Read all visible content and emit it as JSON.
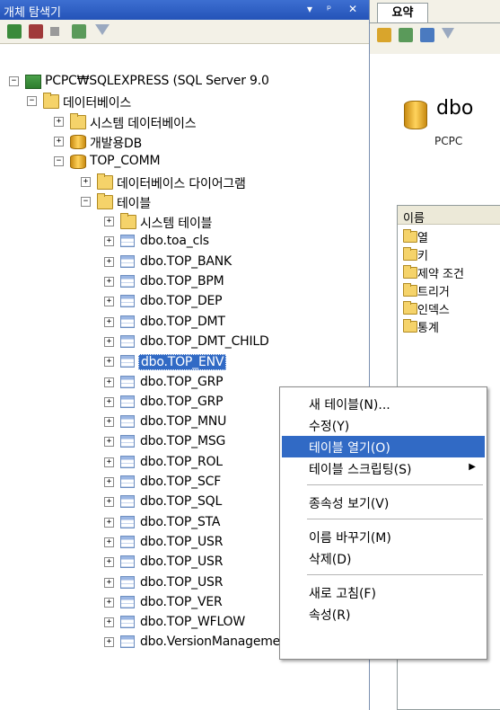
{
  "explorer": {
    "title": "개체 탐색기",
    "controls": [
      "▾",
      "ᵖ",
      "✕"
    ],
    "tree": [
      {
        "label": "PCPC₩SQLEXPRESS (SQL Server 9.0",
        "icon": "server-icon",
        "expander": "−",
        "level": 0
      },
      {
        "label": "데이터베이스",
        "icon": "folder-icon",
        "expander": "−",
        "level": 1
      },
      {
        "label": "시스템 데이터베이스",
        "icon": "folder-icon",
        "expander": "+",
        "level": 2
      },
      {
        "label": "개발용DB",
        "icon": "database-icon",
        "expander": "+",
        "level": 2
      },
      {
        "label": "TOP_COMM",
        "icon": "database-icon",
        "expander": "−",
        "level": 2
      },
      {
        "label": "데이터베이스 다이어그램",
        "icon": "folder-icon",
        "expander": "+",
        "level": 3
      },
      {
        "label": "테이블",
        "icon": "folder-icon",
        "expander": "−",
        "level": 3
      },
      {
        "label": "시스템 테이블",
        "icon": "folder-icon",
        "expander": "+",
        "level": 4
      },
      {
        "label": "dbo.toa_cls",
        "icon": "table-icon",
        "expander": "+",
        "level": 4
      },
      {
        "label": "dbo.TOP_BANK",
        "icon": "table-icon",
        "expander": "+",
        "level": 4
      },
      {
        "label": "dbo.TOP_BPM",
        "icon": "table-icon",
        "expander": "+",
        "level": 4
      },
      {
        "label": "dbo.TOP_DEP",
        "icon": "table-icon",
        "expander": "+",
        "level": 4
      },
      {
        "label": "dbo.TOP_DMT",
        "icon": "table-icon",
        "expander": "+",
        "level": 4
      },
      {
        "label": "dbo.TOP_DMT_CHILD",
        "icon": "table-icon",
        "expander": "+",
        "level": 4
      },
      {
        "label": "dbo.TOP_ENV",
        "icon": "table-icon",
        "expander": "+",
        "level": 4,
        "selected": true
      },
      {
        "label": "dbo.TOP_GRP",
        "icon": "table-icon",
        "expander": "+",
        "level": 4
      },
      {
        "label": "dbo.TOP_GRP",
        "icon": "table-icon",
        "expander": "+",
        "level": 4
      },
      {
        "label": "dbo.TOP_MNU",
        "icon": "table-icon",
        "expander": "+",
        "level": 4
      },
      {
        "label": "dbo.TOP_MSG",
        "icon": "table-icon",
        "expander": "+",
        "level": 4
      },
      {
        "label": "dbo.TOP_ROL",
        "icon": "table-icon",
        "expander": "+",
        "level": 4
      },
      {
        "label": "dbo.TOP_SCF",
        "icon": "table-icon",
        "expander": "+",
        "level": 4
      },
      {
        "label": "dbo.TOP_SQL",
        "icon": "table-icon",
        "expander": "+",
        "level": 4
      },
      {
        "label": "dbo.TOP_STA",
        "icon": "table-icon",
        "expander": "+",
        "level": 4
      },
      {
        "label": "dbo.TOP_USR",
        "icon": "table-icon",
        "expander": "+",
        "level": 4
      },
      {
        "label": "dbo.TOP_USR",
        "icon": "table-icon",
        "expander": "+",
        "level": 4
      },
      {
        "label": "dbo.TOP_USR",
        "icon": "table-icon",
        "expander": "+",
        "level": 4
      },
      {
        "label": "dbo.TOP_VER",
        "icon": "table-icon",
        "expander": "+",
        "level": 4
      },
      {
        "label": "dbo.TOP_WFLOW",
        "icon": "table-icon",
        "expander": "+",
        "level": 4
      },
      {
        "label": "dbo.VersionManagement",
        "icon": "table-icon",
        "expander": "+",
        "level": 4
      }
    ]
  },
  "summary": {
    "tab_label": "요약",
    "object_name": "dbo",
    "object_sub": "PCPC",
    "list_header": "이름",
    "items": [
      "열",
      "키",
      "제약 조건",
      "트리거",
      "인덱스",
      "통계"
    ]
  },
  "context_menu": {
    "items": [
      {
        "label": "새 테이블(N)...",
        "name": "menu-new-table"
      },
      {
        "label": "수정(Y)",
        "name": "menu-modify"
      },
      {
        "label": "테이블 열기(O)",
        "name": "menu-open-table",
        "highlighted": true
      },
      {
        "label": "테이블 스크립팅(S)",
        "name": "menu-script-table",
        "submenu": true
      },
      {
        "separator": true
      },
      {
        "label": "종속성 보기(V)",
        "name": "menu-view-dependencies"
      },
      {
        "separator": true
      },
      {
        "label": "이름 바꾸기(M)",
        "name": "menu-rename"
      },
      {
        "label": "삭제(D)",
        "name": "menu-delete"
      },
      {
        "separator": true
      },
      {
        "label": "새로 고침(F)",
        "name": "menu-refresh"
      },
      {
        "label": "속성(R)",
        "name": "menu-properties"
      }
    ],
    "submenu_arrow": "▶"
  },
  "colors": {
    "selection": "#316ac5",
    "title_bar": "#2453b8"
  }
}
